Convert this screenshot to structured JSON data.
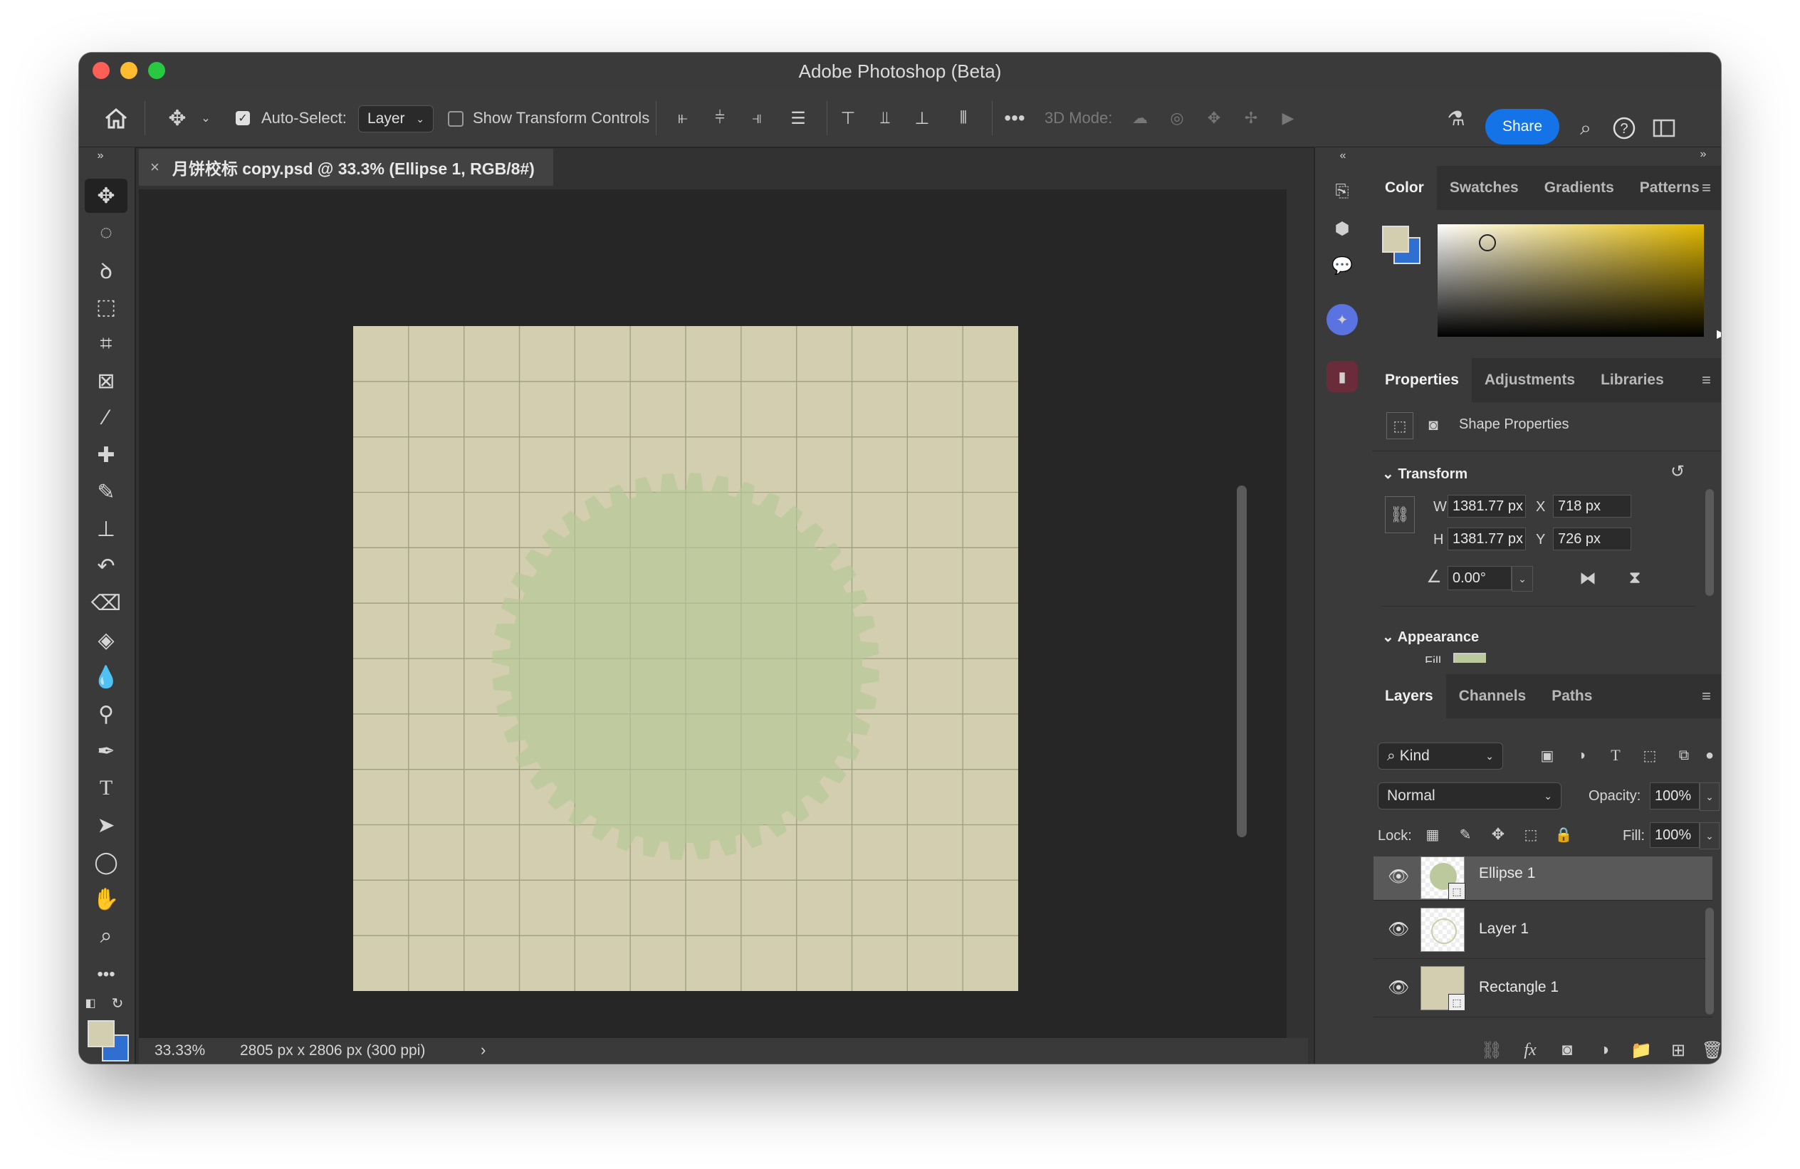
{
  "window": {
    "title": "Adobe Photoshop (Beta)"
  },
  "options_bar": {
    "auto_select_label": "Auto-Select:",
    "auto_select_value": "Layer",
    "show_transform_label": "Show Transform Controls",
    "mode_3d_label": "3D Mode:",
    "share_label": "Share"
  },
  "document": {
    "tab_title": "月饼校标 copy.psd @ 33.3% (Ellipse 1, RGB/8#)",
    "zoom": "33.33%",
    "dimensions": "2805 px x 2806 px (300 ppi)",
    "canvas_bg": "#d3ceaf",
    "shape_color": "#bcc99c"
  },
  "color_panel": {
    "tabs": [
      "Color",
      "Swatches",
      "Gradients",
      "Patterns"
    ],
    "foreground": "#d3ceaf",
    "background": "#2e6fd1"
  },
  "properties_panel": {
    "tabs": [
      "Properties",
      "Adjustments",
      "Libraries"
    ],
    "subtitle": "Shape Properties",
    "transform_label": "Transform",
    "w_label": "W",
    "w_value": "1381.77 px",
    "h_label": "H",
    "h_value": "1381.77 px",
    "x_label": "X",
    "x_value": "718 px",
    "y_label": "Y",
    "y_value": "726 px",
    "angle_value": "0.00°",
    "appearance_label": "Appearance",
    "fill_label": "Fill",
    "fill_color": "#bcc99c"
  },
  "layers_panel": {
    "tabs": [
      "Layers",
      "Channels",
      "Paths"
    ],
    "kind_label": "Kind",
    "blend_mode": "Normal",
    "opacity_label": "Opacity:",
    "opacity_value": "100%",
    "lock_label": "Lock:",
    "fill_label": "Fill:",
    "fill_value": "100%",
    "layers": [
      {
        "name": "Ellipse 1",
        "selected": true
      },
      {
        "name": "Layer 1",
        "selected": false
      },
      {
        "name": "Rectangle 1",
        "selected": false
      }
    ]
  }
}
